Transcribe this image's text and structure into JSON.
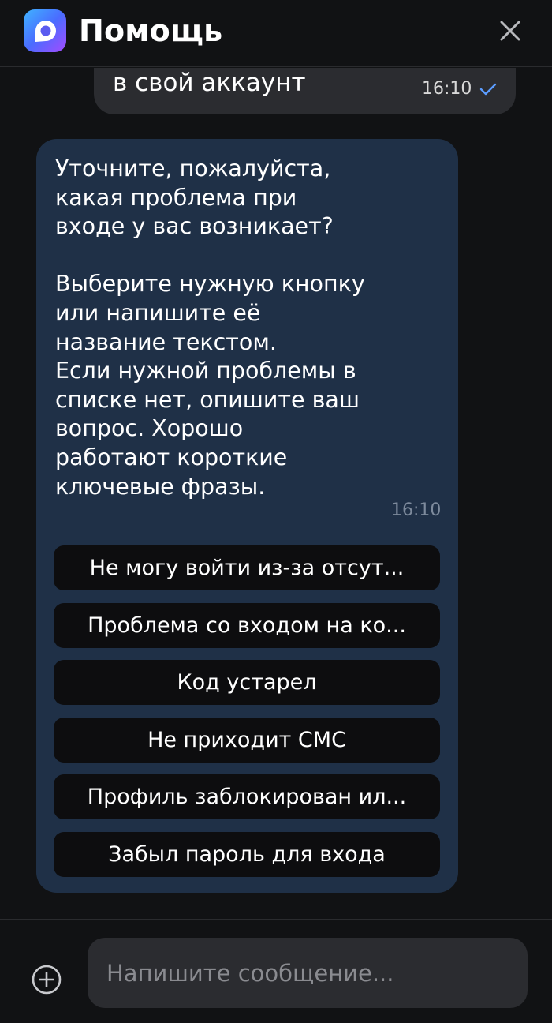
{
  "header": {
    "title": "Помощь",
    "logo_icon": "app-logo-icon",
    "close_icon": "close-icon"
  },
  "chat": {
    "outgoing": {
      "text": "в свой аккаунт",
      "time": "16:10",
      "status_icon": "check-icon"
    },
    "incoming": {
      "text": "Уточните, пожалуйста,\nкакая проблема при\nвходе у вас возникает?\n\nВыберите нужную кнопку\nили напишите её\nназвание текстом.\nЕсли нужной проблемы в\nсписке нет, опишите ваш\nвопрос. Хорошо\nработают короткие\nключевые фразы.",
      "time": "16:10"
    },
    "quick_replies": [
      "Не могу войти из-за отсут...",
      "Проблема со входом на ко...",
      "Код устарел",
      "Не приходит СМС",
      "Профиль заблокирован ил...",
      "Забыл пароль для входа"
    ]
  },
  "composer": {
    "placeholder": "Напишите сообщение...",
    "value": "",
    "attach_icon": "plus-circle-icon"
  },
  "colors": {
    "background": "#111214",
    "incoming_bubble": "#1f3047",
    "outgoing_bubble": "#2b2c30",
    "quick_reply": "#0d0d0f",
    "check": "#5b9cff"
  }
}
